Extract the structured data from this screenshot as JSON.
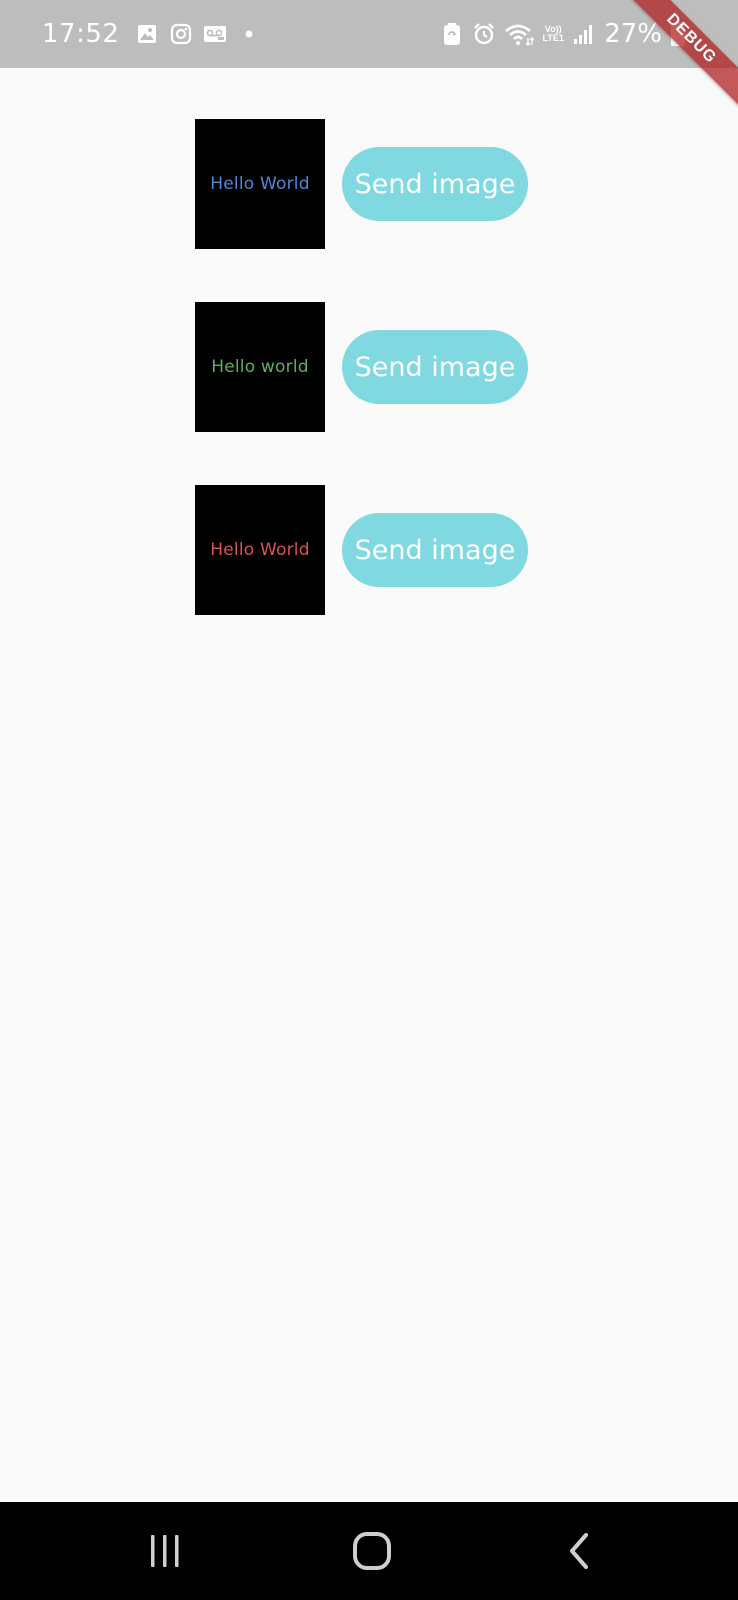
{
  "status_bar": {
    "time": "17:52",
    "battery": "27%",
    "volte_top": "Vo))",
    "volte_bottom": "LTE1",
    "left_icons": [
      "gallery-icon",
      "instagram-icon",
      "voicemail-icon",
      "dot-icon"
    ],
    "right_icons": [
      "battery-saver-icon",
      "alarm-icon",
      "wifi-icon",
      "signal-icon"
    ]
  },
  "debug_banner": "DEBUG",
  "rows": [
    {
      "image_text": "Hello World",
      "image_text_color": "#4f86d9",
      "button_label": "Send image"
    },
    {
      "image_text": "Hello world",
      "image_text_color": "#5fae5f",
      "button_label": "Send image"
    },
    {
      "image_text": "Hello World",
      "image_text_color": "#d9534f",
      "button_label": "Send image"
    }
  ],
  "colors": {
    "button": "#80d8e0",
    "background": "#fafafa",
    "status_bar": "#bdbdbd"
  },
  "nav": {
    "recent_icon": "recent-apps-icon",
    "home_icon": "home-icon",
    "back_icon": "back-icon"
  }
}
